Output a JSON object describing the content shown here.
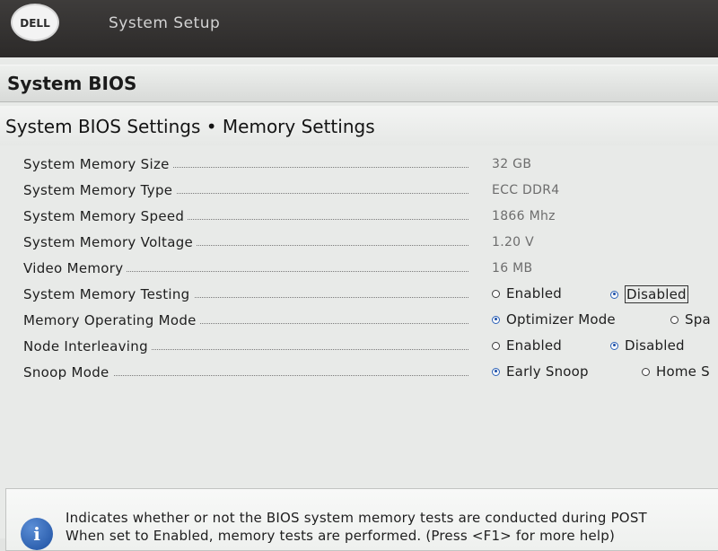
{
  "app": {
    "logo_text": "DELL",
    "title": "System Setup"
  },
  "page": {
    "title": "System BIOS",
    "subtitle": "System BIOS Settings • Memory Settings"
  },
  "settings": [
    {
      "label": "System Memory Size",
      "value": "32 GB"
    },
    {
      "label": "System Memory Type",
      "value": "ECC DDR4"
    },
    {
      "label": "System Memory Speed",
      "value": "1866 Mhz"
    },
    {
      "label": "System Memory Voltage",
      "value": "1.20 V"
    },
    {
      "label": "Video Memory",
      "value": "16 MB"
    },
    {
      "label": "System Memory Testing",
      "options": [
        "Enabled",
        "Disabled"
      ],
      "selected": "Disabled"
    },
    {
      "label": "Memory Operating Mode",
      "options": [
        "Optimizer Mode",
        "Spa"
      ],
      "selected": "Optimizer Mode"
    },
    {
      "label": "Node Interleaving",
      "options": [
        "Enabled",
        "Disabled"
      ],
      "selected": "Disabled"
    },
    {
      "label": "Snoop Mode",
      "options": [
        "Early Snoop",
        "Home S"
      ],
      "selected": "Early Snoop"
    }
  ],
  "help": {
    "line1": "Indicates whether or not the BIOS system memory tests are conducted during POST",
    "line2": "When set to Enabled, memory tests are performed. (Press <F1> for more help)"
  },
  "colors": {
    "topbar": "#353332",
    "panel": "#e8eae8",
    "radio_selected": "#1c4fa8"
  },
  "icons": {
    "logo": "dell-logo",
    "help": "info-icon"
  }
}
